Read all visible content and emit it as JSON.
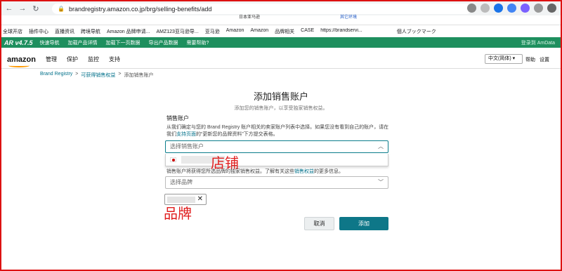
{
  "browser": {
    "url": "brandregistry.amazon.co.jp/brg/selling-benefits/add",
    "top_tabs": [
      "日本亚马逊",
      "其它环境"
    ],
    "bookmarks": [
      "全球开店",
      "插件中心",
      "直播资讯",
      "跨境导航",
      "Amazon 品牌申请...",
      "AMZ123亚马逊导...",
      "亚马逊",
      "Amazon",
      "Amazon",
      "品牌相关",
      "CASE",
      "https://brandservi...",
      "個人ブックマーク"
    ]
  },
  "plugin_bar": {
    "logo": "AR v4.7.5",
    "items": [
      "快速导航",
      "加载产品详情",
      "加载下一页数据",
      "导出产品数据",
      "需要帮助?"
    ],
    "right": "登录到 AmData"
  },
  "header": {
    "logo": "amazon",
    "nav": [
      "管理",
      "保护",
      "监控",
      "支持"
    ],
    "language": "中文(简体)",
    "help": "帮助",
    "settings": "设置"
  },
  "breadcrumb": {
    "items": [
      "Brand Registry",
      "可获得销售权益",
      "添加销售账户"
    ],
    "sep": ">"
  },
  "form": {
    "title": "添加销售账户",
    "subtitle": "添加您的销售账户，以享受独家销售权益。",
    "section_label": "销售账户",
    "description_pre": "从我们确定与您的 Brand Registry 账户相关的卖家账户列表中选择。如果您没有看到自己的账户，请在我们",
    "description_link": "支持页面",
    "description_post": "的“更新您的品牌资料”下方提交表格。",
    "account_placeholder": "选择销售账户",
    "brand_hint_pre": "销售账户将获得您所选品牌的独家销售权益。了解有关这些",
    "brand_hint_link": "销售权益",
    "brand_hint_post": "的更多信息。",
    "brand_placeholder": "选择品牌",
    "chip_remove": "✕",
    "cancel": "取消",
    "add": "添加"
  },
  "annotations": {
    "store": "店铺",
    "brand": "品牌"
  },
  "colors": {
    "plugin_bar": "#1e8f5e",
    "primary_button": "#0e7788",
    "link": "#00708a",
    "annotation": "#e01e1e"
  }
}
